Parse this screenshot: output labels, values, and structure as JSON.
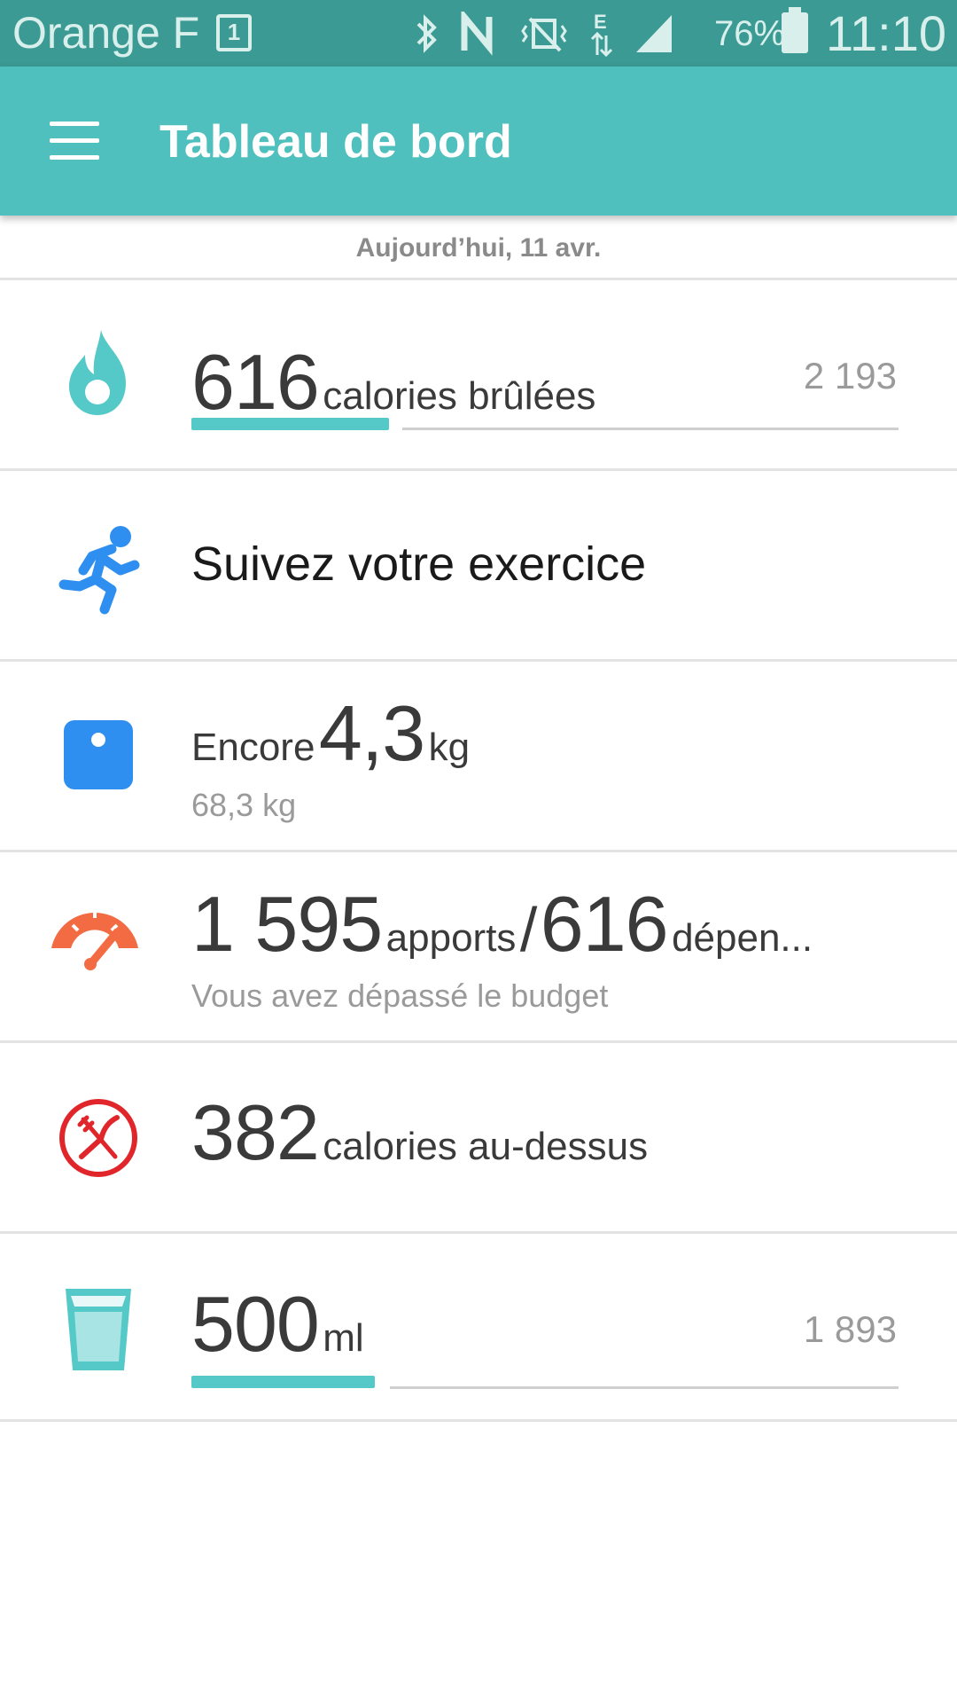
{
  "status_bar": {
    "carrier": "Orange F",
    "sim_slot": "1",
    "battery_percent": "76%",
    "time": "11:10",
    "icons": [
      "bluetooth-icon",
      "nfc-icon",
      "vibrate-icon",
      "data-edge-icon",
      "signal-icon"
    ],
    "edge_label": "E"
  },
  "appbar": {
    "title": "Tableau de bord",
    "background_color": "#4fc0be"
  },
  "date_label": "Aujourd’hui, 11 avr.",
  "tiles": {
    "calories": {
      "value": "616",
      "label": "calories brûlées",
      "goal": "2 193",
      "progress_fraction": 0.28,
      "icon": "flame-icon"
    },
    "exercise": {
      "label": "Suivez votre exercice",
      "icon": "runner-icon"
    },
    "weight": {
      "prefix": "Encore",
      "value": "4,3",
      "unit": "kg",
      "current": "68,3 kg",
      "icon": "scale-icon"
    },
    "budget": {
      "intake": "1 595",
      "intake_label": "apports",
      "separator": "/",
      "burned": "616",
      "burned_label": "dépen...",
      "status": "Vous avez dépassé le budget",
      "icon": "gauge-icon"
    },
    "food": {
      "value": "382",
      "label": "calories au-dessus",
      "icon": "fork-knife-icon"
    },
    "water": {
      "value": "500",
      "unit": "ml",
      "goal": "1 893",
      "progress_fraction": 0.26,
      "icon": "water-glass-icon"
    }
  },
  "colors": {
    "status_bar": "#3b9a93",
    "accent": "#4fc0be",
    "progress": "#55c9c7",
    "food_red": "#e0262b",
    "budget_orange": "#f26b43",
    "exercise_blue": "#2f8ff0"
  }
}
